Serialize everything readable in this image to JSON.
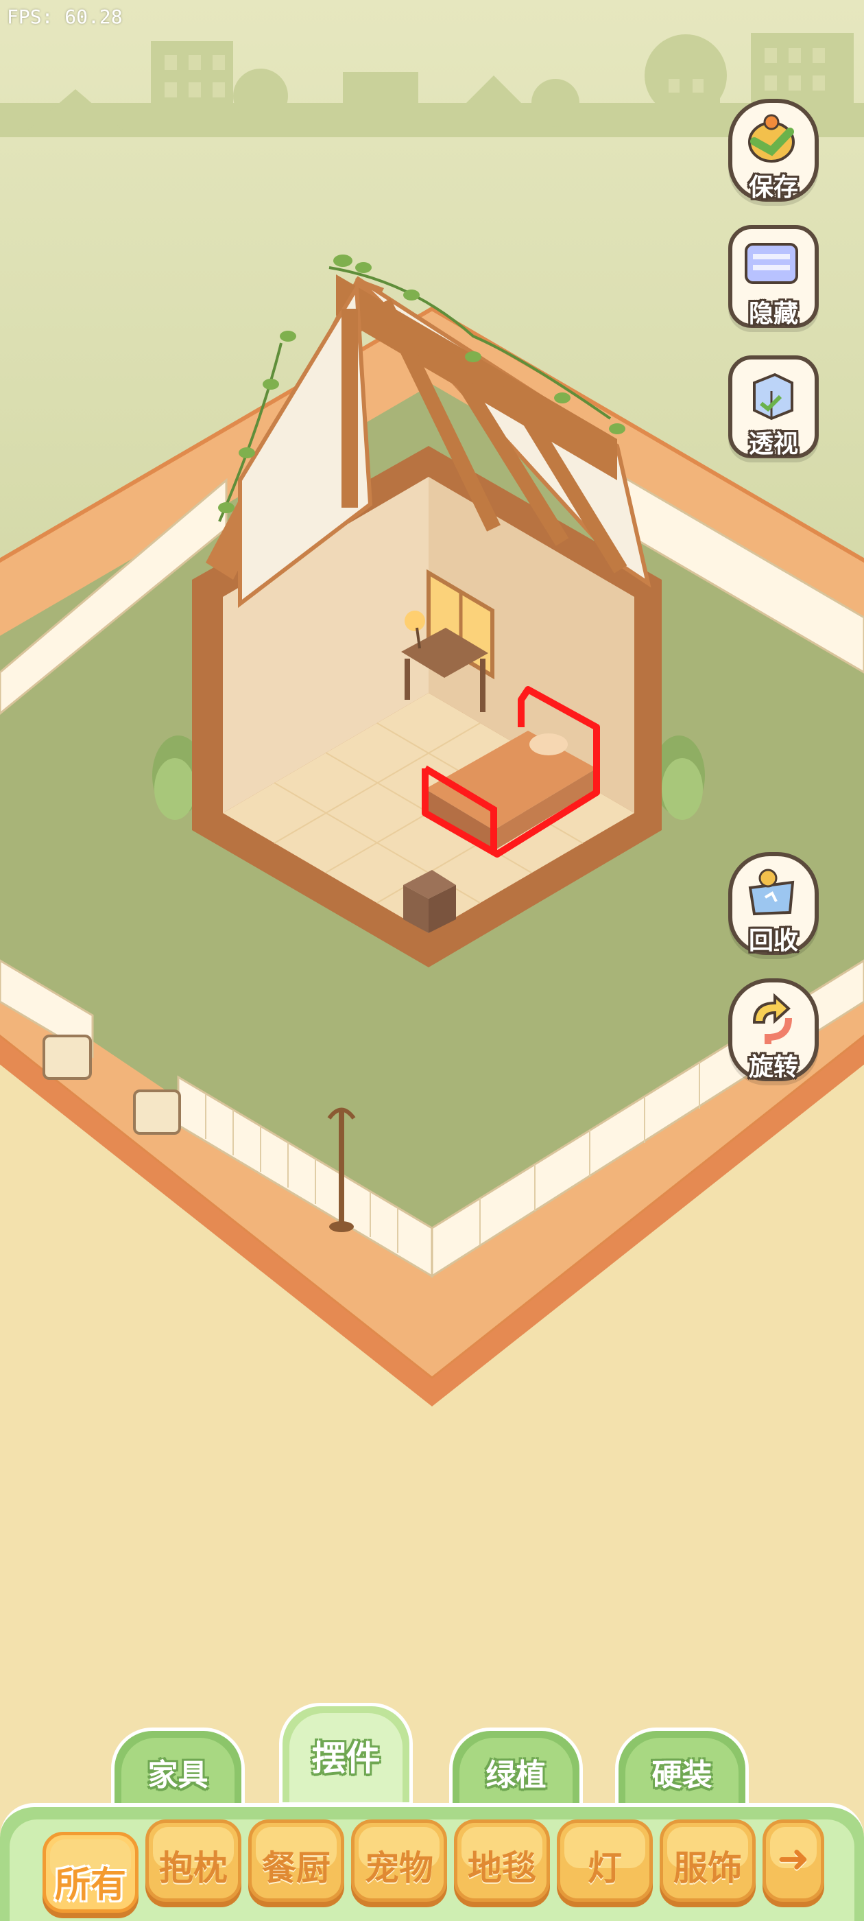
{
  "hud": {
    "fps": "FPS: 60.28"
  },
  "side_buttons": {
    "save": "保存",
    "hide": "隐藏",
    "perspective": "透视",
    "recycle": "回收",
    "rotate": "旋转"
  },
  "category_tabs": [
    {
      "label": "家具",
      "active": false
    },
    {
      "label": "摆件",
      "active": true
    },
    {
      "label": "绿植",
      "active": false
    },
    {
      "label": "硬装",
      "active": false
    }
  ],
  "sub_tabs": [
    {
      "label": "所有",
      "selected": true
    },
    {
      "label": "抱枕",
      "selected": false
    },
    {
      "label": "餐厨",
      "selected": false
    },
    {
      "label": "宠物",
      "selected": false
    },
    {
      "label": "地毯",
      "selected": false
    },
    {
      "label": "灯",
      "selected": false
    },
    {
      "label": "服饰",
      "selected": false
    }
  ],
  "next_arrow_icon": "arrow-right-icon",
  "colors": {
    "sky": "#dde3b4",
    "lawn": "#a8b478",
    "ground": "#f3e1ad",
    "path": "#f0a868",
    "wood": "#b06a3a",
    "selection": "#ff1a1a",
    "tab_green": "#8cc56a",
    "tab_orange": "#f6c15a"
  }
}
